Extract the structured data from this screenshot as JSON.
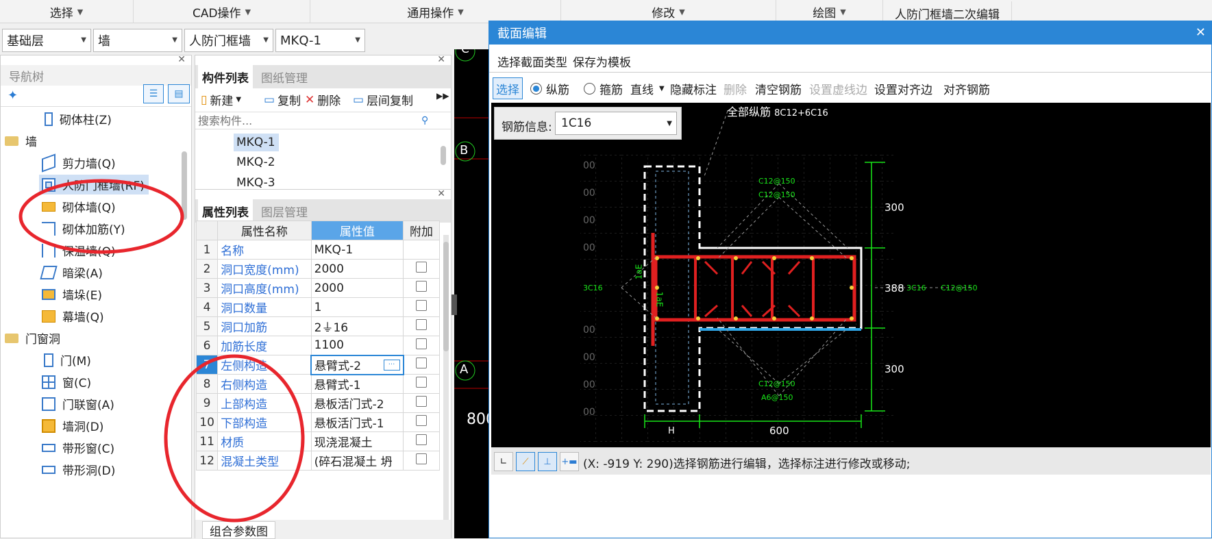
{
  "ribbon": {
    "tabs": [
      {
        "label": "选择"
      },
      {
        "label": "CAD操作"
      },
      {
        "label": "通用操作"
      },
      {
        "label": "修改"
      },
      {
        "label": "绘图"
      },
      {
        "label": "人防门框墙二次编辑"
      }
    ]
  },
  "selectors": {
    "floor": "基础层",
    "category": "墙",
    "type": "人防门框墙",
    "component": "MKQ-1"
  },
  "nav": {
    "title": "导航树",
    "items": [
      {
        "label": "砌体柱(Z)",
        "icon": "masonry-column-icon"
      },
      {
        "label": "墙",
        "icon": "folder-icon"
      },
      {
        "label": "剪力墙(Q)",
        "icon": "shear-wall-icon"
      },
      {
        "label": "人防门框墙(RF)",
        "icon": "civil-defense-door-wall-icon"
      },
      {
        "label": "砌体墙(Q)",
        "icon": "masonry-wall-icon"
      },
      {
        "label": "砌体加筋(Y)",
        "icon": "masonry-rebar-icon"
      },
      {
        "label": "保温墙(Q)",
        "icon": "insulation-wall-icon"
      },
      {
        "label": "暗梁(A)",
        "icon": "hidden-beam-icon"
      },
      {
        "label": "墙垛(E)",
        "icon": "wall-pier-icon"
      },
      {
        "label": "幕墙(Q)",
        "icon": "curtain-wall-icon"
      },
      {
        "label": "门窗洞",
        "icon": "folder-icon"
      },
      {
        "label": "门(M)",
        "icon": "door-icon"
      },
      {
        "label": "窗(C)",
        "icon": "window-icon"
      },
      {
        "label": "门联窗(A)",
        "icon": "door-window-icon"
      },
      {
        "label": "墙洞(D)",
        "icon": "wall-hole-icon"
      },
      {
        "label": "带形窗(C)",
        "icon": "strip-window-icon"
      },
      {
        "label": "带形洞(D)",
        "icon": "strip-hole-icon"
      }
    ]
  },
  "components": {
    "tabs": [
      "构件列表",
      "图纸管理"
    ],
    "toolbar": {
      "new": "新建",
      "copy": "复制",
      "delete": "删除",
      "floor_copy": "层间复制"
    },
    "search_placeholder": "搜索构件...",
    "list": [
      "MKQ-1",
      "MKQ-2",
      "MKQ-3"
    ]
  },
  "properties": {
    "tabs": [
      "属性列表",
      "图层管理"
    ],
    "headers": [
      "属性名称",
      "属性值",
      "附加"
    ],
    "rows": [
      {
        "n": "1",
        "name": "名称",
        "value": "MKQ-1"
      },
      {
        "n": "2",
        "name": "洞口宽度(mm)",
        "value": "2000"
      },
      {
        "n": "3",
        "name": "洞口高度(mm)",
        "value": "2000"
      },
      {
        "n": "4",
        "name": "洞口数量",
        "value": "1"
      },
      {
        "n": "5",
        "name": "洞口加筋",
        "value": "2⏚16"
      },
      {
        "n": "6",
        "name": "加筋长度",
        "value": "1100"
      },
      {
        "n": "7",
        "name": "左侧构造",
        "value": "悬臂式-2"
      },
      {
        "n": "8",
        "name": "右侧构造",
        "value": "悬臂式-1"
      },
      {
        "n": "9",
        "name": "上部构造",
        "value": "悬板活门式-2"
      },
      {
        "n": "10",
        "name": "下部构造",
        "value": "悬板活门式-1"
      },
      {
        "n": "11",
        "name": "材质",
        "value": "现浇混凝土"
      },
      {
        "n": "12",
        "name": "混凝土类型",
        "value": "(碎石混凝土 坍"
      }
    ],
    "bottom_tab": "组合参数图"
  },
  "cad": {
    "axis_c": "C",
    "axis_b": "B",
    "axis_a": "A",
    "dim": "800"
  },
  "dialog": {
    "title": "截面编辑",
    "menu": {
      "select_type": "选择截面类型",
      "save_template": "保存为模板"
    },
    "toolbar": {
      "select": "选择",
      "longitudinal": "纵筋",
      "stirrup": "箍筋",
      "line": "直线",
      "hide_label": "隐藏标注",
      "delete": "删除",
      "clear_rebar": "清空钢筋",
      "dashed_edge": "设置虚线边",
      "align_edge": "设置对齐边",
      "align_rebar": "对齐钢筋"
    },
    "rebar_info_label": "钢筋信息:",
    "rebar_info_value": "1C16",
    "annotations": {
      "all_long": "全部纵筋",
      "all_long_value": "8C12+6C16",
      "top1": "C12@150",
      "top2": "C12@150",
      "bot1": "C12@150",
      "bot2": "A6@150",
      "left": "3C16",
      "right_dim": "388",
      "right_r1": "3C16",
      "right_r2": "C12@150",
      "dim_top": "300",
      "dim_bot": "300",
      "dim_w": "600",
      "dim_h": "H",
      "lae": "1aE",
      "grid": "00"
    },
    "status": "(X: -919 Y: 290)选择钢筋进行编辑，选择标注进行修改或移动;"
  }
}
